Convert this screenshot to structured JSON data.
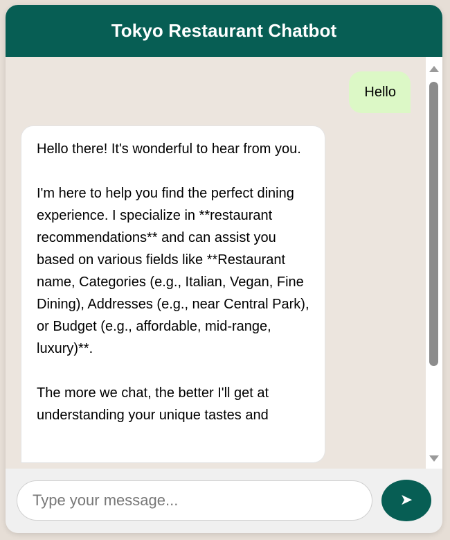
{
  "header": {
    "title": "Tokyo Restaurant Chatbot"
  },
  "messages": {
    "user_1": "Hello",
    "bot_1": {
      "para_1": "Hello there! It's wonderful to hear from you.",
      "para_2": "I'm here to help you find the perfect dining experience. I specialize in **restaurant recommendations** and can assist you based on various fields like **Restaurant name, Categories (e.g., Italian, Vegan, Fine Dining), Addresses (e.g., near Central Park), or Budget (e.g., affordable, mid-range, luxury)**.",
      "para_3": "The more we chat, the better I'll get at understanding your unique tastes and"
    }
  },
  "input": {
    "placeholder": "Type your message...",
    "value": ""
  },
  "send_button": {
    "icon": "send-arrow-icon",
    "glyph": "➤"
  },
  "colors": {
    "header_bg": "#075e54",
    "user_bubble": "#dcf8c6",
    "bot_bubble": "#ffffff",
    "chat_bg": "#ece5de",
    "send_bg": "#075e54"
  }
}
